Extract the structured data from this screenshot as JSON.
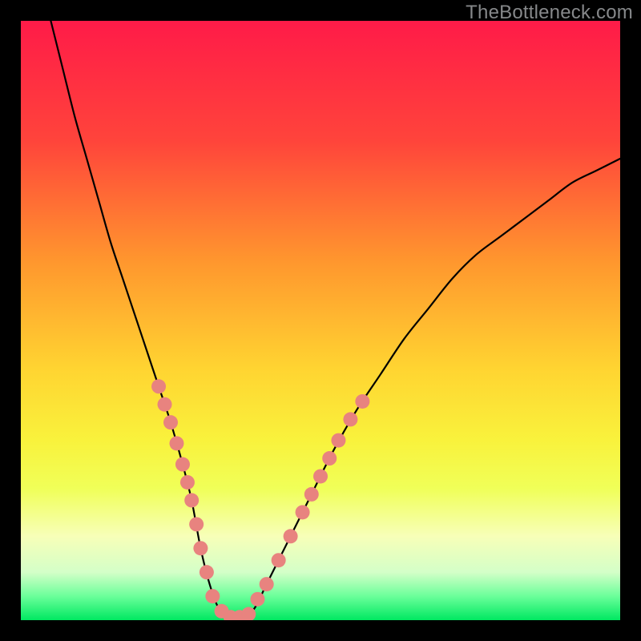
{
  "watermark": "TheBottleneck.com",
  "chart_data": {
    "type": "line",
    "title": "",
    "xlabel": "",
    "ylabel": "",
    "xlim": [
      0,
      100
    ],
    "ylim": [
      0,
      100
    ],
    "gradient_stops": [
      {
        "offset": 0,
        "color": "#ff1b48"
      },
      {
        "offset": 20,
        "color": "#ff443b"
      },
      {
        "offset": 40,
        "color": "#ff962e"
      },
      {
        "offset": 58,
        "color": "#ffd431"
      },
      {
        "offset": 70,
        "color": "#f9f23c"
      },
      {
        "offset": 78,
        "color": "#f0ff58"
      },
      {
        "offset": 86,
        "color": "#f7ffb8"
      },
      {
        "offset": 92,
        "color": "#d4ffc8"
      },
      {
        "offset": 96,
        "color": "#6bff9a"
      },
      {
        "offset": 100,
        "color": "#00e861"
      }
    ],
    "series": [
      {
        "name": "bottleneck-curve",
        "x": [
          5,
          7,
          9,
          11,
          13,
          15,
          17,
          19,
          21,
          23,
          25,
          27,
          28.5,
          30,
          31.5,
          33,
          35,
          37,
          39,
          41,
          44,
          48,
          52,
          56,
          60,
          64,
          68,
          72,
          76,
          80,
          84,
          88,
          92,
          96,
          100
        ],
        "y": [
          100,
          92,
          84,
          77,
          70,
          63,
          57,
          51,
          45,
          39,
          33,
          26,
          20,
          12,
          6,
          2,
          0,
          0,
          2,
          6,
          12,
          20,
          28,
          35,
          41,
          47,
          52,
          57,
          61,
          64,
          67,
          70,
          73,
          75,
          77
        ]
      }
    ],
    "markers": {
      "name": "highlight-dots",
      "color": "#e8837f",
      "radius": 9,
      "points": [
        {
          "x": 23.0,
          "y": 39.0
        },
        {
          "x": 24.0,
          "y": 36.0
        },
        {
          "x": 25.0,
          "y": 33.0
        },
        {
          "x": 26.0,
          "y": 29.5
        },
        {
          "x": 27.0,
          "y": 26.0
        },
        {
          "x": 27.8,
          "y": 23.0
        },
        {
          "x": 28.5,
          "y": 20.0
        },
        {
          "x": 29.3,
          "y": 16.0
        },
        {
          "x": 30.0,
          "y": 12.0
        },
        {
          "x": 31.0,
          "y": 8.0
        },
        {
          "x": 32.0,
          "y": 4.0
        },
        {
          "x": 33.5,
          "y": 1.5
        },
        {
          "x": 35.0,
          "y": 0.5
        },
        {
          "x": 36.5,
          "y": 0.5
        },
        {
          "x": 38.0,
          "y": 1.0
        },
        {
          "x": 39.5,
          "y": 3.5
        },
        {
          "x": 41.0,
          "y": 6.0
        },
        {
          "x": 43.0,
          "y": 10.0
        },
        {
          "x": 45.0,
          "y": 14.0
        },
        {
          "x": 47.0,
          "y": 18.0
        },
        {
          "x": 48.5,
          "y": 21.0
        },
        {
          "x": 50.0,
          "y": 24.0
        },
        {
          "x": 51.5,
          "y": 27.0
        },
        {
          "x": 53.0,
          "y": 30.0
        },
        {
          "x": 55.0,
          "y": 33.5
        },
        {
          "x": 57.0,
          "y": 36.5
        }
      ]
    }
  }
}
